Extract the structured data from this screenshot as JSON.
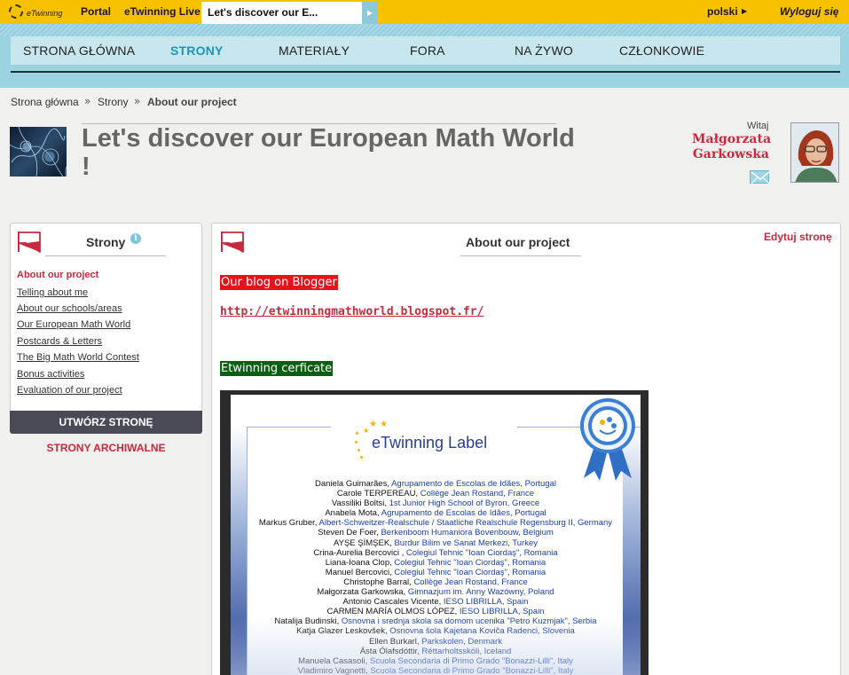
{
  "topbar": {
    "portal": "Portal",
    "live": "eTwinning Live",
    "tab_title": "Let's discover our E...",
    "language": "polski",
    "logout": "Wyloguj się",
    "logo_text": "eTwinning"
  },
  "nav": {
    "items": [
      "STRONA GŁÓWNA",
      "STRONY",
      "MATERIAŁY",
      "FORA",
      "NA ŻYWO",
      "CZŁONKOWIE"
    ],
    "active": "STRONY"
  },
  "breadcrumb": [
    "Strona główna",
    "Strony",
    "About our project"
  ],
  "header": {
    "title": "Let's discover our European Math World !",
    "welcome": "Witaj",
    "user_name": "Małgorzata Garkowska"
  },
  "sidebar": {
    "title": "Strony",
    "items": [
      "About our project",
      "Telling about me",
      "About our schools/areas",
      "Our European Math World",
      "Postcards & Letters",
      "The Big Math World Contest",
      "Bonus activities",
      "Evaluation of our project"
    ],
    "active_index": 0,
    "create_button": "UTWÓRZ STRONĘ",
    "archive_link": "STRONY ARCHIWALNE"
  },
  "main": {
    "title": "About our project",
    "edit_link": "Edytuj stronę",
    "blog_heading": "Our blog on Blogger",
    "blog_url": "http://etwinningmathworld.blogspot.fr/",
    "cert_heading": "Etwinning cerficate"
  },
  "certificate": {
    "label": "eTwinning Label",
    "ribbon_text": "Label",
    "entries": [
      {
        "name": "Daniela Guimarães, ",
        "school": "Agrupamento de Escolas de Idães, Portugal"
      },
      {
        "name": "Carole TERPEREAU, ",
        "school": "Collège Jean Rostand, France"
      },
      {
        "name": "Vassiliki Boltsi, ",
        "school": "1st Junior High School of Byron, Greece"
      },
      {
        "name": "Anabela Mota, ",
        "school": "Agrupamento de Escolas de Idães, Portugal"
      },
      {
        "name": "Markus Gruber, ",
        "school": "Albert-Schweitzer-Realschule / Staatliche Realschule Regensburg II, Germany"
      },
      {
        "name": "Steven De Foer, ",
        "school": "Berkenboom Humaniora Bovenbouw, Belgium"
      },
      {
        "name": "AYŞE ŞİMŞEK, ",
        "school": "Burdur Bilim ve Sanat Merkezi, Turkey"
      },
      {
        "name": "Crina-Aurelia Bercovici , ",
        "school": "Colegiul Tehnic \"Ioan Ciordaş\", Romania"
      },
      {
        "name": "Liana-Ioana Clop, ",
        "school": "Colegiul Tehnic \"Ioan Ciordaş\", Romania"
      },
      {
        "name": "Manuel Bercovici, ",
        "school": "Colegiul Tehnic \"Ioan Ciordaş\", Romania"
      },
      {
        "name": "Christophe Barral, ",
        "school": "Collège Jean Rostand, France"
      },
      {
        "name": "Małgorzata Garkowska, ",
        "school": "Gimnazjum im. Anny Wazówny, Poland"
      },
      {
        "name": "Antonio Cascales Vicente, ",
        "school": "IESO LIBRILLA, Spain"
      },
      {
        "name": "CARMEN MARÍA OLMOS LÓPEZ, ",
        "school": "IESO LIBRILLA, Spain"
      },
      {
        "name": "Natalija Budinski, ",
        "school": "Osnovna i srednja skola sa domom ucenika \"Petro Kuzmjak\", Serbia"
      },
      {
        "name": "Katja Glazer Leskovšek, ",
        "school": "Osnovna šola Kajetana Koviča Radenci, Slovenia"
      },
      {
        "name": "Ellen Burkarl, ",
        "school": "Parkskolen, Denmark"
      },
      {
        "name": "Ásta Ólafsdóttir, ",
        "school": "Réttarholtsskóli, Iceland"
      },
      {
        "name": "Manuela Casasoli, ",
        "school": "Scuola Secondaria di Primo Grado \"Bonazzi-Lilli\", Italy"
      },
      {
        "name": "Vladimiro Vagnetti, ",
        "school": "Scuola Secondaria di Primo Grado \"Bonazzi-Lilli\", Italy"
      }
    ]
  },
  "colors": {
    "topbar": "#f7c100",
    "nav_band": "#9cd3e0",
    "nav_active": "#1c95bd",
    "accent_red": "#c8293e",
    "create_button": "#4a4a56",
    "blog_highlight": "#e8121d",
    "cert_highlight": "#0b5f12"
  },
  "icons": {
    "logo": "etwinning-logo-icon",
    "tab_arrow": "play-arrow-icon",
    "language_arrow": "triangle-right-icon",
    "page_flag": "page-flag-icon",
    "info": "info-icon",
    "mail": "envelope-icon"
  }
}
